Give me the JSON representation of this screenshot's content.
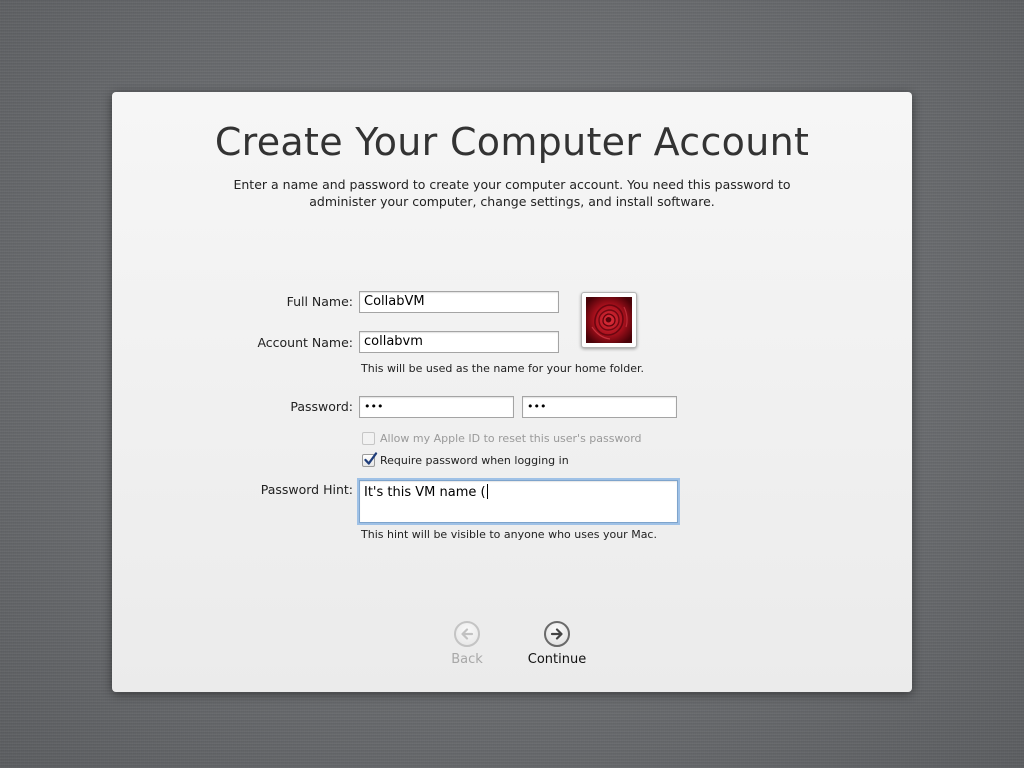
{
  "dialog": {
    "title": "Create Your Computer Account",
    "subtitle_line1": "Enter a name and password to create your computer account. You need this password to",
    "subtitle_line2": "administer your computer, change settings, and install software."
  },
  "form": {
    "full_name_label": "Full Name:",
    "full_name_value": "CollabVM",
    "account_name_label": "Account Name:",
    "account_name_value": "collabvm",
    "account_name_note": "This will be used as the name for your home folder.",
    "password_label": "Password:",
    "password_value": "•••",
    "verify_value": "•••",
    "apple_id_checkbox_label": "Allow my Apple ID to reset this user's password",
    "apple_id_checked": false,
    "apple_id_enabled": false,
    "require_password_label": "Require password when logging in",
    "require_password_checked": true,
    "hint_label": "Password Hint:",
    "hint_value": "It's this VM name (",
    "hint_note": "This hint will be visible to anyone who uses your Mac."
  },
  "avatar": {
    "icon": "red-rose-picture",
    "description_color": "#b0101e"
  },
  "navigation": {
    "back_label": "Back",
    "back_enabled": false,
    "continue_label": "Continue",
    "continue_enabled": true
  },
  "colors": {
    "panel": "#f0f0f0",
    "focus_ring": "#9fc1e6",
    "background": "#6e7073"
  }
}
